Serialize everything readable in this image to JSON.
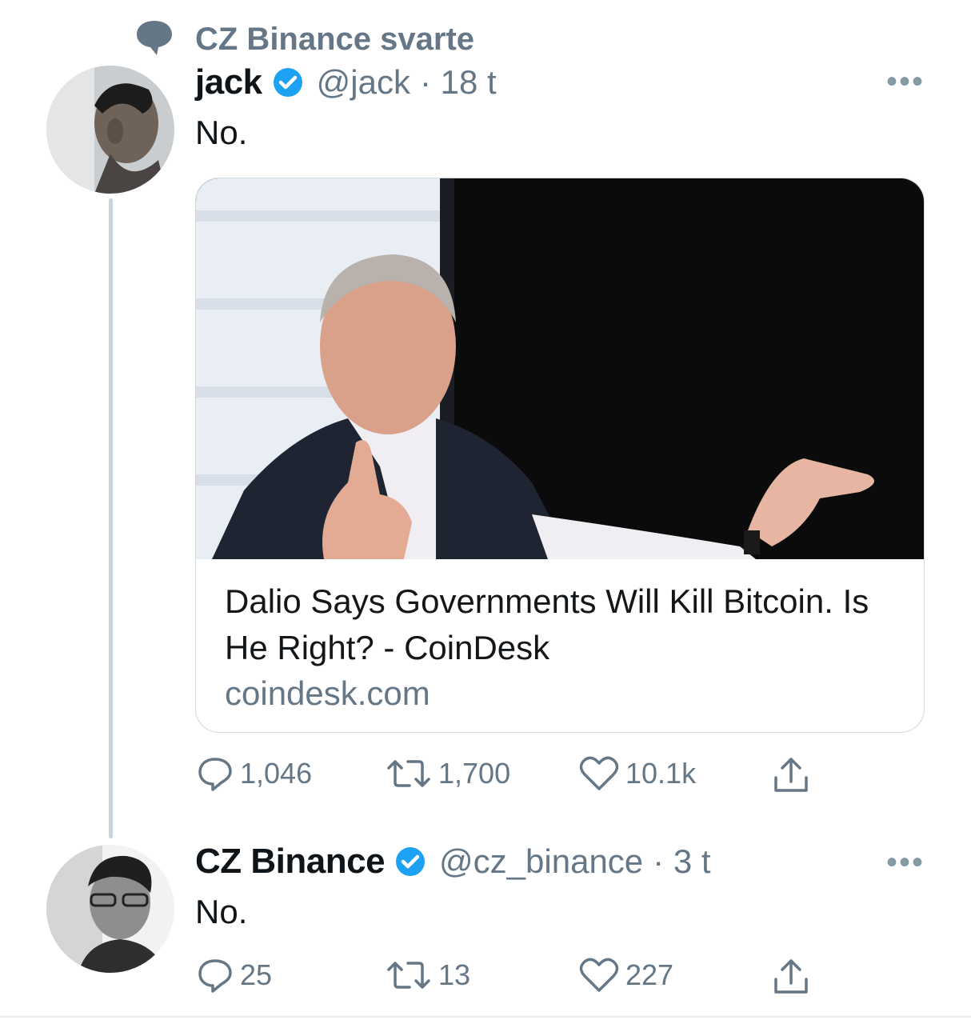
{
  "header": {
    "replied_label": "CZ Binance svarte",
    "icon": "speech-bubble-icon"
  },
  "tweets": [
    {
      "author": "jack",
      "handle": "@jack",
      "time": "· 18 t",
      "text": "No.",
      "card": {
        "title": "Dalio Says Governments Will Kill Bitcoin. Is He Right? - CoinDesk",
        "domain": "coindesk.com"
      },
      "actions": {
        "replies": "1,046",
        "retweets": "1,700",
        "likes": "10.1k"
      }
    },
    {
      "author": "CZ Binance",
      "handle": "@cz_binance",
      "time": "· 3 t",
      "text": "No.",
      "actions": {
        "replies": "25",
        "retweets": "13",
        "likes": "227"
      }
    }
  ],
  "more_label": "•••",
  "colors": {
    "verified": "#1da1f2",
    "muted": "#657786",
    "thread_line": "#c9d4dc"
  }
}
